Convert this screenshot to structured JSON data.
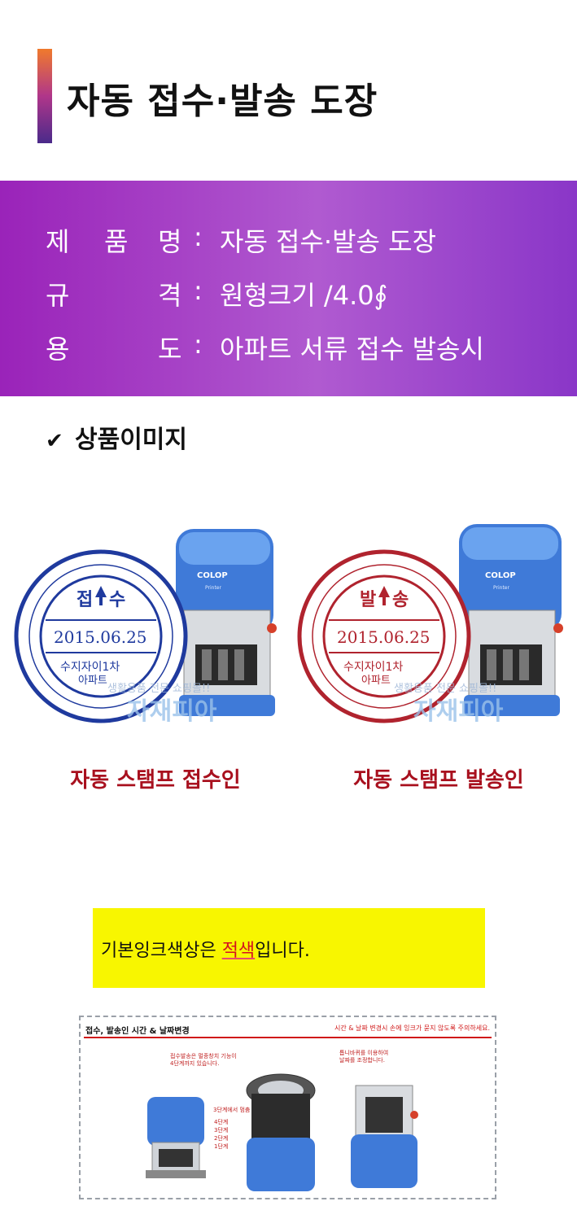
{
  "title": "자동 접수·발송 도장",
  "specs": [
    {
      "k1": "제",
      "k2": "품",
      "k3": "명",
      "colon": ":",
      "value": "자동 접수·발송 도장"
    },
    {
      "k1": "규",
      "k2": "",
      "k3": "격",
      "colon": ":",
      "value": "원형크기 /4.0∮"
    },
    {
      "k1": "용",
      "k2": "",
      "k3": "도",
      "colon": ":",
      "value": "아파트 서류 접수 발송시"
    }
  ],
  "section": {
    "check_icon": "check-icon",
    "label": "상품이미지"
  },
  "products": [
    {
      "stamp_word_a": "접",
      "stamp_word_b": "수",
      "date": "2015.06.25",
      "line1": "수지자이1차",
      "line2": "아파트",
      "brand": "COLOP",
      "model": "Printer",
      "watermark_top": "생활용품 전문 쇼핑몰!!",
      "watermark": "자재피아",
      "caption": "자동 스탬프 접수인",
      "ink_color": "#1f3a9e"
    },
    {
      "stamp_word_a": "발",
      "stamp_word_b": "송",
      "date": "2015.06.25",
      "line1": "수지자이1차",
      "line2": "아파트",
      "brand": "COLOP",
      "model": "Printer",
      "watermark_top": "생활용품 전문 쇼핑몰!!",
      "watermark": "자재피아",
      "caption": "자동 스탬프 발송인",
      "ink_color": "#b0232e"
    }
  ],
  "ink_notice": {
    "before": "기본잉크색상은 ",
    "highlight": "적색",
    "after": "입니다."
  },
  "guide": {
    "title": "접수, 발송인 시간 & 날짜변경",
    "note": "시간 & 날짜 변경시 손에 잉크가 묻지 않도록 주의하세요.",
    "tip_left_1": "접수발송은 멀종창치 기능이",
    "tip_left_2": "4단계까지 있습니다.",
    "tip_right_1": "톱니바퀴를 이용하여",
    "tip_right_2": "날짜를 조정합니다.",
    "steps_head": "3단계에서 멈춤",
    "steps": [
      "4단계",
      "3단계",
      "2단계",
      "1단계"
    ]
  },
  "colors": {
    "band_start": "#9a23b9",
    "band_end": "#8a36c8",
    "caption_red": "#a8101e",
    "ink_yellow": "#f8f600"
  }
}
